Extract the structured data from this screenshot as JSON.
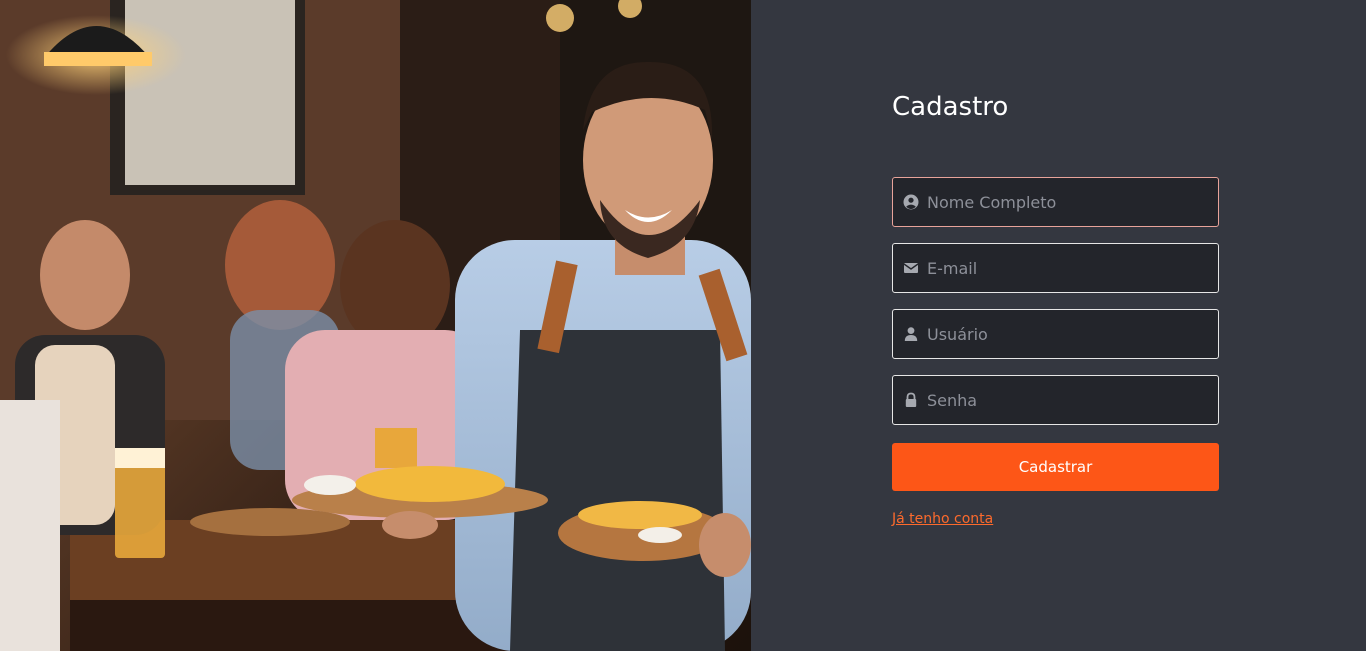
{
  "form": {
    "title": "Cadastro",
    "fields": [
      {
        "placeholder": "Nome Completo",
        "icon": "user-circle-icon",
        "value": ""
      },
      {
        "placeholder": "E-mail",
        "icon": "envelope-icon",
        "value": ""
      },
      {
        "placeholder": "Usuário",
        "icon": "user-icon",
        "value": ""
      },
      {
        "placeholder": "Senha",
        "icon": "lock-icon",
        "value": ""
      }
    ],
    "submit_label": "Cadastrar",
    "login_link": "Já tenho conta"
  },
  "colors": {
    "accent": "#fd5617",
    "panel_bg": "#343740",
    "field_bg": "#23252b",
    "link": "#fd6a2c"
  }
}
